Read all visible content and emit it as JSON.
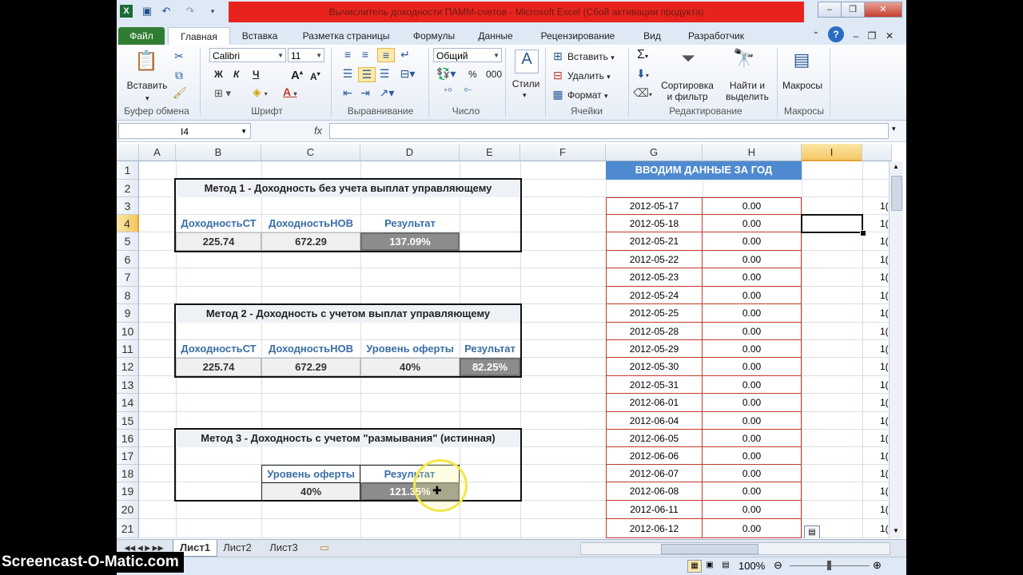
{
  "window": {
    "title": "Вычислитель доходности ПАММ-счетов  -  Microsoft Excel (Сбой активации продукта)",
    "controls": [
      "–",
      "❐",
      "✕"
    ]
  },
  "tabs": [
    "Файл",
    "Главная",
    "Вставка",
    "Разметка страницы",
    "Формулы",
    "Данные",
    "Рецензирование",
    "Вид",
    "Разработчик"
  ],
  "ribbon": {
    "paste_label": "Вставить",
    "font_name": "Calibri",
    "font_size": "11",
    "number_format": "Общий",
    "styles_label": "Стили",
    "insert_label": "Вставить",
    "delete_label": "Удалить",
    "format_label": "Формат",
    "sort_label_1": "Сортировка",
    "sort_label_2": "и фильтр",
    "find_label_1": "Найти и",
    "find_label_2": "выделить",
    "macros_label": "Макросы",
    "bold": "Ж",
    "italic": "К",
    "underline": "Ч",
    "percent": "%",
    "thousands": "000",
    "groups": [
      "Буфер обмена",
      "Шрифт",
      "Выравнивание",
      "Число",
      "Ячейки",
      "Редактирование",
      "Макросы"
    ]
  },
  "formula_bar": {
    "name_box": "I4",
    "fx": "fx",
    "formula": ""
  },
  "columns": [
    "A",
    "B",
    "C",
    "D",
    "E",
    "F",
    "G",
    "H",
    "I"
  ],
  "rows": [
    "1",
    "2",
    "3",
    "4",
    "5",
    "6",
    "7",
    "8",
    "9",
    "10",
    "11",
    "12",
    "13",
    "14",
    "15",
    "16",
    "17",
    "18",
    "19",
    "20",
    "21"
  ],
  "method1": {
    "title": "Метод 1 - Доходность без учета выплат управляющему",
    "headers": [
      "ДоходностьСТ",
      "ДоходностьНОВ",
      "Результат"
    ],
    "values": [
      "225.74",
      "672.29",
      "137.09%"
    ]
  },
  "method2": {
    "title": "Метод 2 - Доходность с учетом выплат управляющему",
    "headers": [
      "ДоходностьСТ",
      "ДоходностьНОВ",
      "Уровень оферты",
      "Результат"
    ],
    "values": [
      "225.74",
      "672.29",
      "40%",
      "82.25%"
    ]
  },
  "method3": {
    "title": "Метод 3 - Доходность с учетом \"размывания\" (истинная)",
    "headers": [
      "Уровень оферты",
      "Результат"
    ],
    "values": [
      "40%",
      "121.35%"
    ]
  },
  "yearly": {
    "header": "ВВОДИМ ДАННЫЕ ЗА ГОД",
    "rows": [
      {
        "date": "2012-05-17",
        "value": "0.00"
      },
      {
        "date": "2012-05-18",
        "value": "0.00"
      },
      {
        "date": "2012-05-21",
        "value": "0.00"
      },
      {
        "date": "2012-05-22",
        "value": "0.00"
      },
      {
        "date": "2012-05-23",
        "value": "0.00"
      },
      {
        "date": "2012-05-24",
        "value": "0.00"
      },
      {
        "date": "2012-05-25",
        "value": "0.00"
      },
      {
        "date": "2012-05-28",
        "value": "0.00"
      },
      {
        "date": "2012-05-29",
        "value": "0.00"
      },
      {
        "date": "2012-05-30",
        "value": "0.00"
      },
      {
        "date": "2012-05-31",
        "value": "0.00"
      },
      {
        "date": "2012-06-01",
        "value": "0.00"
      },
      {
        "date": "2012-06-04",
        "value": "0.00"
      },
      {
        "date": "2012-06-05",
        "value": "0.00"
      },
      {
        "date": "2012-06-06",
        "value": "0.00"
      },
      {
        "date": "2012-06-07",
        "value": "0.00"
      },
      {
        "date": "2012-06-08",
        "value": "0.00"
      },
      {
        "date": "2012-06-11",
        "value": "0.00"
      },
      {
        "date": "2012-06-12",
        "value": "0.00"
      }
    ],
    "edge_text": "1("
  },
  "sheets": [
    "Лист1",
    "Лист2",
    "Лист3"
  ],
  "status": {
    "zoom": "100%"
  },
  "watermark": "Screencast-O-Matic.com"
}
